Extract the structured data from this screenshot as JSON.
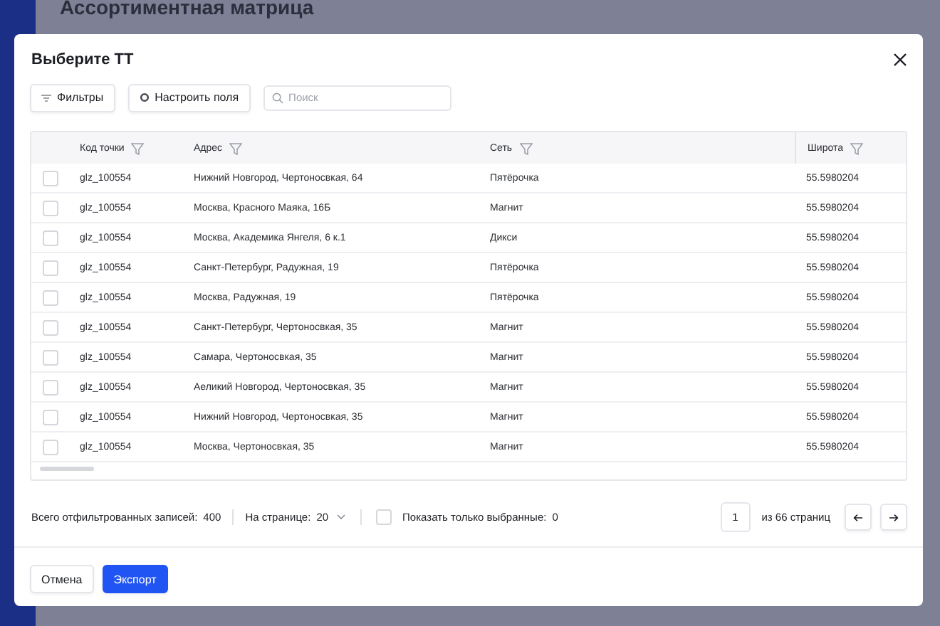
{
  "page": {
    "title": "Ассортиментная матрица"
  },
  "dialog": {
    "title": "Выберите ТТ",
    "toolbar": {
      "filters_button": "Фильтры",
      "fields_button": "Настроить поля",
      "search": {
        "placeholder": "Поиск"
      }
    },
    "table": {
      "columns": [
        {
          "label": "Код точки"
        },
        {
          "label": "Адрес"
        },
        {
          "label": "Сеть"
        },
        {
          "label": "Широта"
        }
      ],
      "rows": [
        {
          "selected": false,
          "cells": [
            "glz_100554",
            "Нижний Новгород, Чертоносвкая, 64",
            "Пятёрочка",
            "55.5980204"
          ]
        },
        {
          "selected": false,
          "cells": [
            "glz_100554",
            "Москва, Красного Маяка, 16Б",
            "Магнит",
            "55.5980204"
          ]
        },
        {
          "selected": false,
          "cells": [
            "glz_100554",
            "Москва, Академика Янгеля, 6 к.1",
            "Дикси",
            "55.5980204"
          ]
        },
        {
          "selected": false,
          "cells": [
            "glz_100554",
            "Санкт-Петербург, Радужная, 19",
            "Пятёрочка",
            "55.5980204"
          ]
        },
        {
          "selected": false,
          "cells": [
            "glz_100554",
            "Москва, Радужная, 19",
            "Пятёрочка",
            "55.5980204"
          ]
        },
        {
          "selected": false,
          "cells": [
            "glz_100554",
            "Санкт-Петербург, Чертоносвкая, 35",
            "Магнит",
            "55.5980204"
          ]
        },
        {
          "selected": false,
          "cells": [
            "glz_100554",
            "Самара, Чертоносвкая, 35",
            "Магнит",
            "55.5980204"
          ]
        },
        {
          "selected": false,
          "cells": [
            "glz_100554",
            "Аеликий Новгород, Чертоносвкая, 35",
            "Магнит",
            "55.5980204"
          ]
        },
        {
          "selected": false,
          "cells": [
            "glz_100554",
            "Нижний Новгород, Чертоносвкая, 35",
            "Магнит",
            "55.5980204"
          ]
        },
        {
          "selected": false,
          "cells": [
            "glz_100554",
            "Москва, Чертоносвкая, 35",
            "Магнит",
            "55.5980204"
          ]
        }
      ]
    },
    "footer": {
      "total_label": "Всего отфильтрованных записей:",
      "total": "400",
      "per_page_label": "На странице:",
      "per_page": "20",
      "show_selected": {
        "label": "Показать только выбранные:",
        "checked": false,
        "count": "0"
      },
      "page": "1",
      "pages_label": "из 66 страниц"
    },
    "buttons": [
      {
        "label": "Отмена",
        "kind": "secondary"
      },
      {
        "label": "Экспорт",
        "kind": "primary"
      }
    ]
  }
}
